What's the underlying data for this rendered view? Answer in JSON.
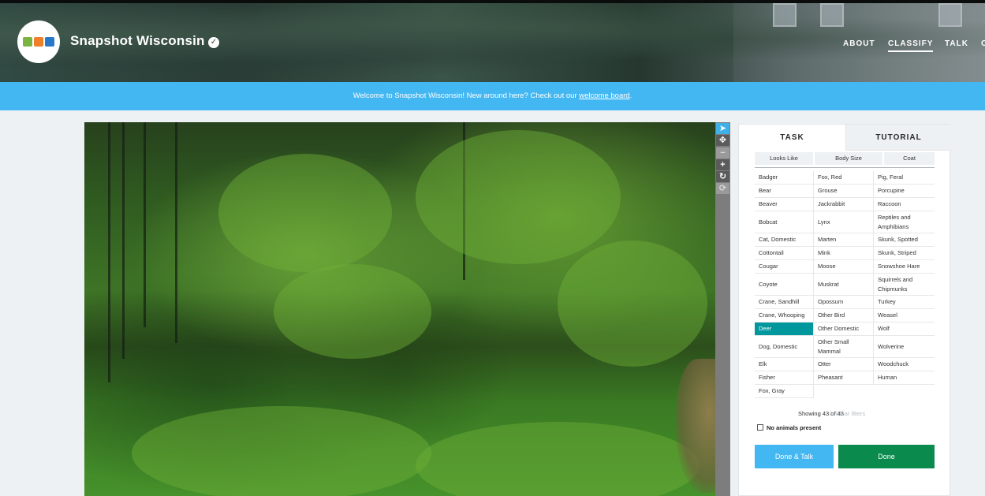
{
  "header": {
    "project_title": "Snapshot Wisconsin",
    "nav": [
      {
        "label": "ABOUT"
      },
      {
        "label": "CLASSIFY"
      },
      {
        "label": "TALK"
      },
      {
        "label": "C"
      }
    ],
    "active_nav": "CLASSIFY"
  },
  "banner": {
    "text": "Welcome to Snapshot Wisconsin! New around here? Check out our ",
    "link": "welcome board",
    "suffix": "."
  },
  "toolbar": {
    "tools": [
      "pointer-icon",
      "move-icon",
      "zoom-out-icon",
      "zoom-in-icon",
      "rotate-icon",
      "reset-icon"
    ]
  },
  "task": {
    "tabs": [
      {
        "label": "TASK"
      },
      {
        "label": "TUTORIAL"
      }
    ],
    "filters": [
      {
        "label": "Looks Like"
      },
      {
        "label": "Body Size"
      },
      {
        "label": "Coat"
      }
    ],
    "col1": [
      "Badger",
      "Bear",
      "Beaver",
      "Bobcat",
      "Cat, Domestic",
      "Cottontail",
      "Cougar",
      "Coyote",
      "Crane, Sandhill",
      "Crane, Whooping",
      "Deer",
      "Dog, Domestic",
      "Elk",
      "Fisher",
      "Fox, Gray"
    ],
    "col2": [
      "Fox, Red",
      "Grouse",
      "Jackrabbit",
      "Lynx",
      "Marten",
      "Mink",
      "Moose",
      "Muskrat",
      "Opossum",
      "Other Bird",
      "Other Domestic",
      "Other Small Mammal",
      "Otter",
      "Pheasant"
    ],
    "col3": [
      "Pig, Feral",
      "Porcupine",
      "Raccoon",
      "Reptiles and Amphibians",
      "Skunk, Spotted",
      "Skunk, Striped",
      "Snowshoe Hare",
      "Squirrels and Chipmunks",
      "Turkey",
      "Weasel",
      "Wolf",
      "Wolverine",
      "Woodchuck",
      "Human"
    ],
    "selected": "Deer",
    "showing": "Showing 43 of 43",
    "clear_filters": "Clear filters",
    "no_animals": "No animals present",
    "done_talk": "Done & Talk",
    "done": "Done"
  },
  "colors": {
    "banner": "#43b7f2",
    "selected": "#00979d",
    "done": "#0a8a4c",
    "done_talk": "#43b7f2"
  }
}
